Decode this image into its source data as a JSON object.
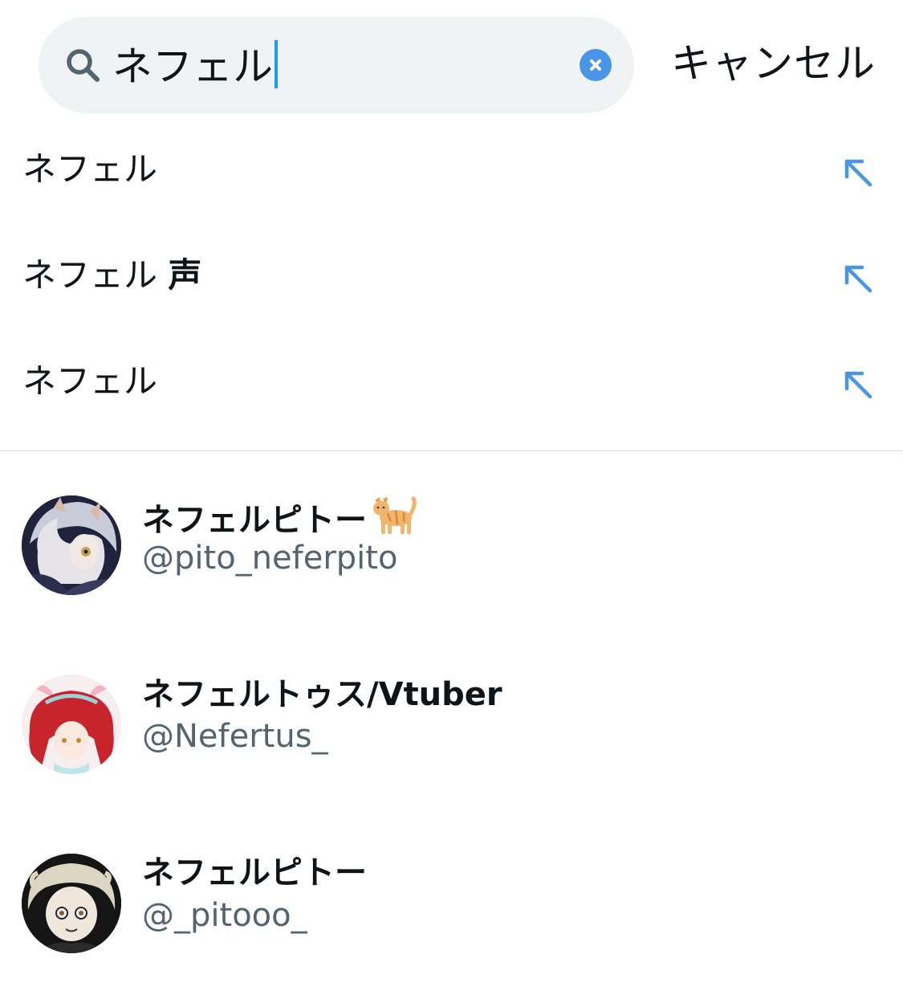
{
  "search": {
    "query": "ネフェル",
    "cancel_label": "キャンセル"
  },
  "suggestions": [
    {
      "label": "ネフェル",
      "suffix": ""
    },
    {
      "label": "ネフェル",
      "suffix": "声"
    },
    {
      "label": "ネフェル",
      "suffix": ""
    }
  ],
  "users": [
    {
      "name": "ネフェルピトー",
      "emoji_icon": "cat-icon",
      "handle": "@pito_neferpito"
    },
    {
      "name": "ネフェルトゥス/Vtuber",
      "handle": "@Nefertus_"
    },
    {
      "name": "ネフェルピトー",
      "handle": "@_pitooo_"
    }
  ],
  "colors": {
    "accent": "#1d9bf0",
    "arrow": "#4a95e6",
    "handle": "#536471",
    "search_bg": "#eff3f4"
  }
}
